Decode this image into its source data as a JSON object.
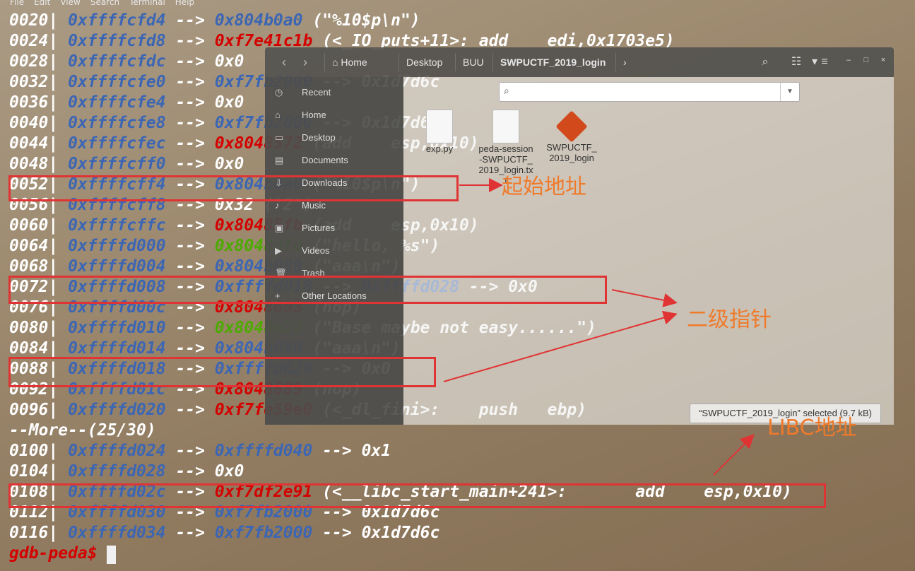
{
  "menu": [
    "File",
    "Edit",
    "View",
    "Search",
    "Terminal",
    "Help"
  ],
  "terminal_lines": [
    {
      "off": "0020|",
      "addr": "0xffffcfd4",
      "parts": [
        {
          "t": " --> ",
          "c": "wh"
        },
        {
          "t": "0x804b0a0",
          "c": "addr"
        },
        {
          "t": " (\"%10$p\\n\")",
          "c": "wh"
        }
      ]
    },
    {
      "off": "0024|",
      "addr": "0xffffcfd8",
      "parts": [
        {
          "t": " --> ",
          "c": "wh"
        },
        {
          "t": "0xf7e41c1b",
          "c": "red"
        },
        {
          "t": " (<_IO_puts+11>: add    edi,0x1703e5)",
          "c": "wh"
        }
      ]
    },
    {
      "off": "0028|",
      "addr": "0xffffcfdc",
      "parts": [
        {
          "t": " --> 0x0",
          "c": "wh"
        }
      ]
    },
    {
      "off": "0032|",
      "addr": "0xffffcfe0",
      "parts": [
        {
          "t": " --> ",
          "c": "wh"
        },
        {
          "t": "0xf7fb2000",
          "c": "addr"
        },
        {
          "t": " --> 0x1d7d6c",
          "c": "wh"
        }
      ]
    },
    {
      "off": "0036|",
      "addr": "0xffffcfe4",
      "parts": [
        {
          "t": " --> 0x0",
          "c": "wh"
        }
      ]
    },
    {
      "off": "0040|",
      "addr": "0xffffcfe8",
      "parts": [
        {
          "t": " --> ",
          "c": "wh"
        },
        {
          "t": "0xf7fb2000",
          "c": "addr"
        },
        {
          "t": " --> 0x1d7d6c",
          "c": "wh"
        }
      ]
    },
    {
      "off": "0044|",
      "addr": "0xffffcfec",
      "parts": [
        {
          "t": " --> ",
          "c": "wh"
        },
        {
          "t": "0x8048572",
          "c": "red"
        },
        {
          "t": " (add    esp,0x10)",
          "c": "wh"
        }
      ]
    },
    {
      "off": "0048|",
      "addr": "0xffffcff0",
      "parts": [
        {
          "t": " --> 0x0",
          "c": "wh"
        }
      ]
    },
    {
      "off": "0052|",
      "addr": "0xffffcff4",
      "parts": [
        {
          "t": " --> ",
          "c": "wh"
        },
        {
          "t": "0x804b0a0",
          "c": "addr"
        },
        {
          "t": " (\"%10$p\\n\")",
          "c": "wh"
        }
      ]
    },
    {
      "off": "0056|",
      "addr": "0xffffcff8",
      "parts": [
        {
          "t": " --> 0x32 ('2')",
          "c": "wh"
        }
      ]
    },
    {
      "off": "0060|",
      "addr": "0xffffcffc",
      "parts": [
        {
          "t": " --> ",
          "c": "wh"
        },
        {
          "t": "0x80485fb",
          "c": "red"
        },
        {
          "t": " (add    esp,0x10)",
          "c": "wh"
        }
      ]
    },
    {
      "off": "0064|",
      "addr": "0xffffd000",
      "parts": [
        {
          "t": " --> ",
          "c": "wh"
        },
        {
          "t": "0x8048dfd",
          "c": "green"
        },
        {
          "t": " (\"hello, %s\")",
          "c": "wh"
        }
      ]
    },
    {
      "off": "0068|",
      "addr": "0xffffd004",
      "parts": [
        {
          "t": " --> ",
          "c": "wh"
        },
        {
          "t": "0x804b080",
          "c": "addr"
        },
        {
          "t": " (\"aaa\\n\")",
          "c": "wh"
        }
      ]
    },
    {
      "off": "0072|",
      "addr": "0xffffd008",
      "parts": [
        {
          "t": " --> ",
          "c": "wh"
        },
        {
          "t": "0xffffd018",
          "c": "addr"
        },
        {
          "t": " --> ",
          "c": "wh"
        },
        {
          "t": "0xffffd028",
          "c": "addr"
        },
        {
          "t": " --> 0x0",
          "c": "wh"
        }
      ]
    },
    {
      "off": "0076|",
      "addr": "0xffffd00c",
      "parts": [
        {
          "t": " --> ",
          "c": "wh"
        },
        {
          "t": "0x8048603",
          "c": "red"
        },
        {
          "t": " (nop)",
          "c": "wh"
        }
      ]
    },
    {
      "off": "0080|",
      "addr": "0xffffd010",
      "parts": [
        {
          "t": " --> ",
          "c": "wh"
        },
        {
          "t": "0x8048e20",
          "c": "green"
        },
        {
          "t": " (\"Base maybe not easy......\")",
          "c": "wh"
        }
      ]
    },
    {
      "off": "0084|",
      "addr": "0xffffd014",
      "parts": [
        {
          "t": " --> ",
          "c": "wh"
        },
        {
          "t": "0x804b080",
          "c": "addr"
        },
        {
          "t": " (\"aaa\\n\")",
          "c": "wh"
        }
      ]
    },
    {
      "off": "0088|",
      "addr": "0xffffd018",
      "parts": [
        {
          "t": " --> ",
          "c": "wh"
        },
        {
          "t": "0xffffd028",
          "c": "addr"
        },
        {
          "t": " --> 0x0",
          "c": "wh"
        }
      ]
    },
    {
      "off": "0092|",
      "addr": "0xffffd01c",
      "parts": [
        {
          "t": " --> ",
          "c": "wh"
        },
        {
          "t": "0x8048689",
          "c": "red"
        },
        {
          "t": " (nop)",
          "c": "wh"
        }
      ]
    },
    {
      "off": "0096|",
      "addr": "0xffffd020",
      "parts": [
        {
          "t": " --> ",
          "c": "wh"
        },
        {
          "t": "0xf7fe59e0",
          "c": "red"
        },
        {
          "t": " (<_dl_fini>:    push   ebp)",
          "c": "wh"
        }
      ]
    },
    {
      "off": "--More--(25/30)",
      "addr": "",
      "parts": []
    },
    {
      "off": "0100|",
      "addr": "0xffffd024",
      "parts": [
        {
          "t": " --> ",
          "c": "wh"
        },
        {
          "t": "0xffffd040",
          "c": "addr"
        },
        {
          "t": " --> 0x1",
          "c": "wh"
        }
      ]
    },
    {
      "off": "0104|",
      "addr": "0xffffd028",
      "parts": [
        {
          "t": " --> 0x0",
          "c": "wh"
        }
      ]
    },
    {
      "off": "0108|",
      "addr": "0xffffd02c",
      "parts": [
        {
          "t": " --> ",
          "c": "wh"
        },
        {
          "t": "0xf7df2e91",
          "c": "red"
        },
        {
          "t": " (<__libc_start_main+241>:       add    esp,0x10)",
          "c": "wh"
        }
      ]
    },
    {
      "off": "0112|",
      "addr": "0xffffd030",
      "parts": [
        {
          "t": " --> ",
          "c": "wh"
        },
        {
          "t": "0xf7fb2000",
          "c": "addr"
        },
        {
          "t": " --> 0x1d7d6c",
          "c": "wh"
        }
      ]
    },
    {
      "off": "0116|",
      "addr": "0xffffd034",
      "parts": [
        {
          "t": " --> ",
          "c": "wh"
        },
        {
          "t": "0xf7fb2000",
          "c": "addr"
        },
        {
          "t": " --> 0x1d7d6c",
          "c": "wh"
        }
      ]
    }
  ],
  "prompt": "gdb-peda$",
  "file_manager": {
    "breadcrumbs": [
      "Home",
      "Desktop",
      "BUU",
      "SWPUCTF_2019_login"
    ],
    "sidebar": [
      "Recent",
      "Home",
      "Desktop",
      "Documents",
      "Downloads",
      "Music",
      "Pictures",
      "Videos",
      "Trash",
      "Other Locations"
    ],
    "files": [
      {
        "name": "exp.py",
        "kind": "doc"
      },
      {
        "name": "peda-session-SWPUCTF_2019_login.txt",
        "kind": "doc"
      },
      {
        "name": "SWPUCTF_2019_login",
        "kind": "exec"
      }
    ],
    "status": "“SWPUCTF_2019_login” selected (9.7 kB)"
  },
  "annotations": {
    "start_addr": "起始地址",
    "double_ptr": "二级指针",
    "libc_addr": "LIBC地址"
  },
  "colors": {
    "offset": "#ffffff",
    "addr_blue": "#3c66b4",
    "red": "#d40000",
    "green": "#4caa00",
    "annotation": "#f07a2a",
    "box": "#e03434"
  }
}
